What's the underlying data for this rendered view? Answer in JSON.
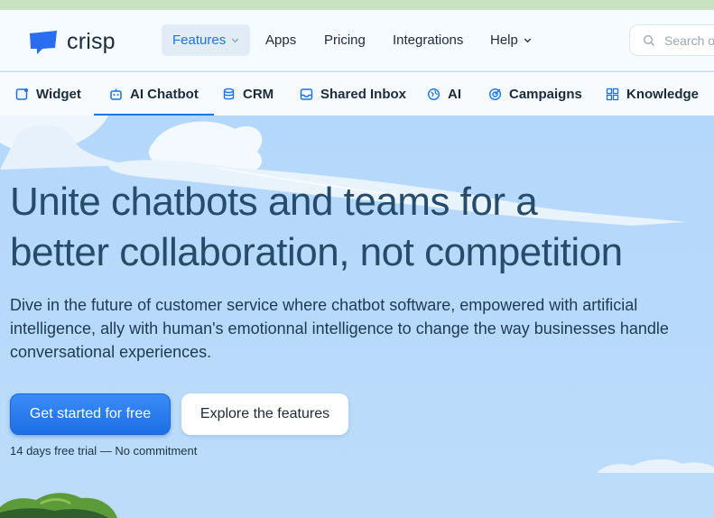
{
  "brand": {
    "name": "crisp",
    "color": "#2a6ef0"
  },
  "header": {
    "nav": [
      {
        "label": "Features",
        "dropdown": true,
        "active": true
      },
      {
        "label": "Apps"
      },
      {
        "label": "Pricing"
      },
      {
        "label": "Integrations"
      },
      {
        "label": "Help",
        "dropdown": true
      }
    ],
    "search": {
      "placeholder": "Search o",
      "icon": "search-icon"
    }
  },
  "subnav": {
    "tabs": [
      {
        "label": "Widget",
        "icon": "widget-icon"
      },
      {
        "label": "AI Chatbot",
        "icon": "bot-icon",
        "active": true
      },
      {
        "label": "CRM",
        "icon": "database-icon"
      },
      {
        "label": "Shared Inbox",
        "icon": "inbox-icon"
      },
      {
        "label": "AI",
        "icon": "ai-globe-icon"
      },
      {
        "label": "Campaigns",
        "icon": "target-icon"
      },
      {
        "label": "Knowledge",
        "icon": "grid-icon"
      }
    ]
  },
  "hero": {
    "headline_line1": "Unite chatbots and teams for a",
    "headline_line2": "better collaboration, not competition",
    "description": "Dive in the future of customer service where chatbot software, empowered with artificial intelligence, ally with human's emotionnal intelligence to change the way businesses handle conversational experiences.",
    "cta_primary": "Get started for free",
    "cta_secondary": "Explore the features",
    "trial_note": "14 days free trial — No commitment"
  },
  "colors": {
    "accent": "#1a73e8",
    "heading": "#264c6b",
    "sky": "#b9dcfb"
  }
}
